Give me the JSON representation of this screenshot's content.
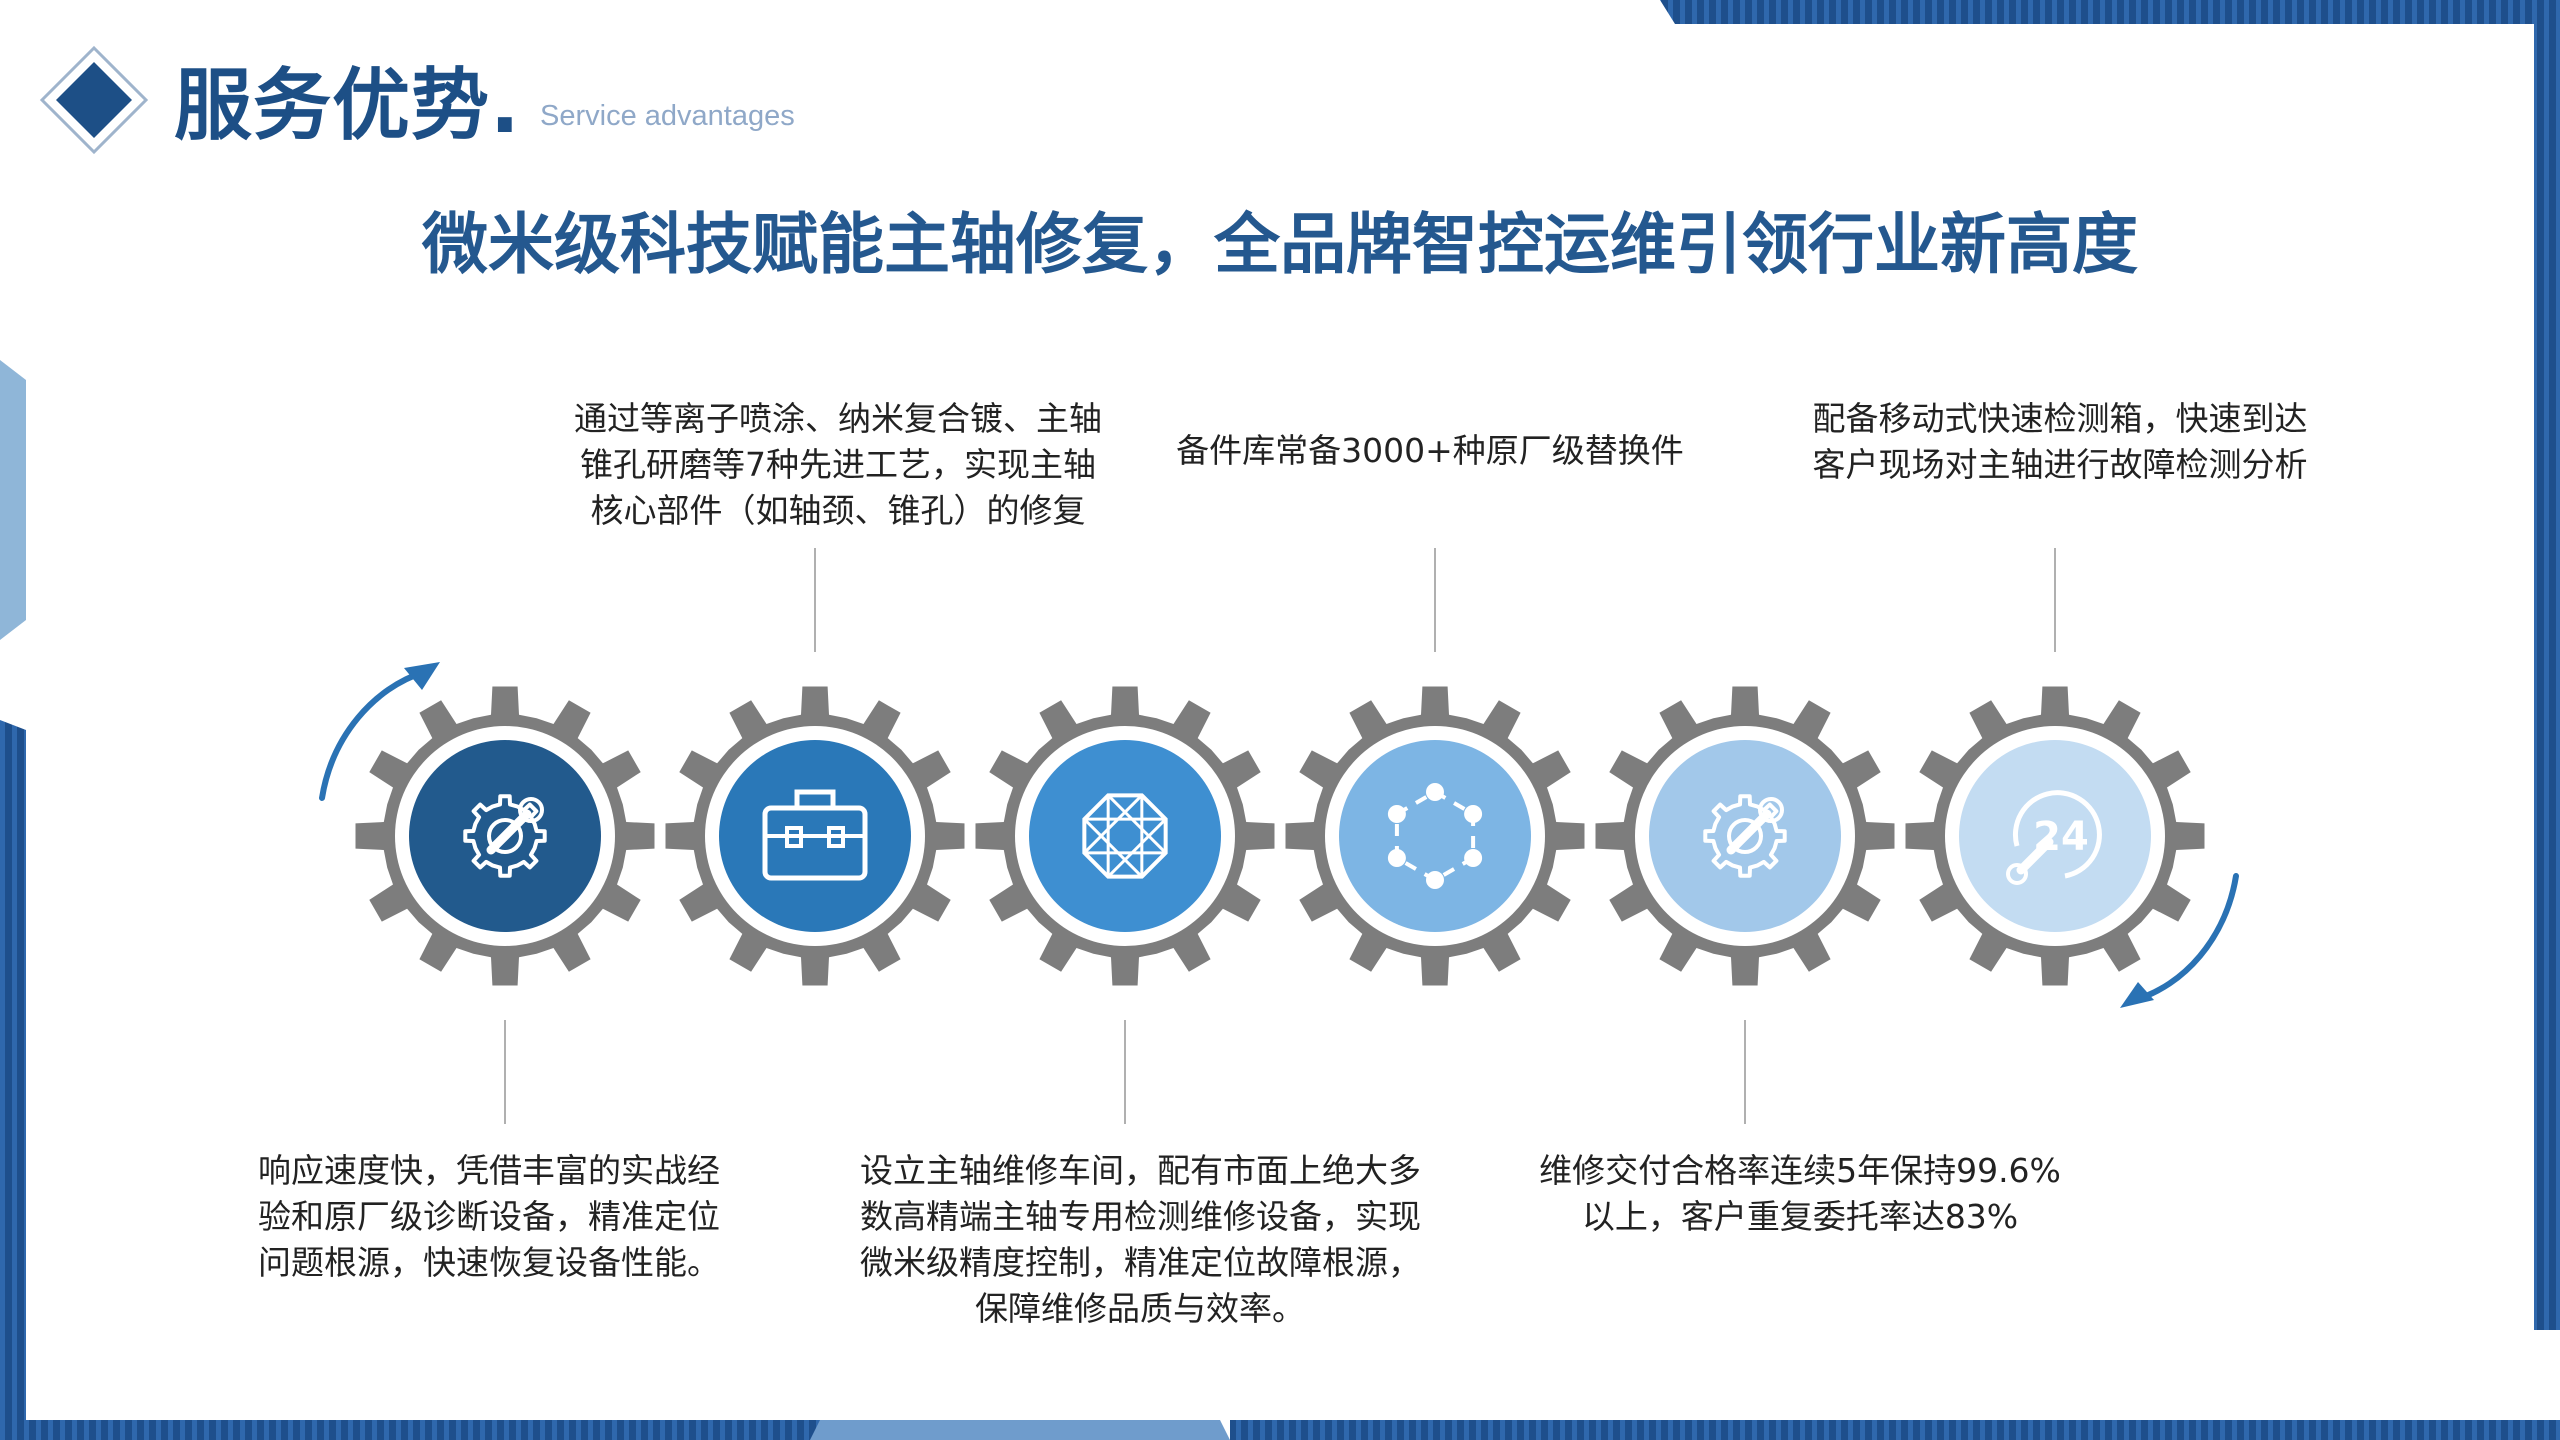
{
  "header": {
    "title": "服务优势.",
    "subtitle": "Service advantages"
  },
  "headline": "微米级科技赋能主轴修复，全品牌智控运维引领行业新高度",
  "colors": {
    "brand_dark": "#1d4f86",
    "gear_gray": "#7d7d7d",
    "circles": [
      "#225a8d",
      "#2a78b8",
      "#3e8fd1",
      "#7db5e4",
      "#a2c8ea",
      "#c3dcf2"
    ]
  },
  "gears": [
    {
      "icon": "wrench-gear-icon"
    },
    {
      "icon": "briefcase-icon"
    },
    {
      "icon": "diamond-icon"
    },
    {
      "icon": "hexagon-nodes-icon"
    },
    {
      "icon": "wrench-gear-icon"
    },
    {
      "icon": "24-hour-service-icon"
    }
  ],
  "descriptions": {
    "top": [
      {
        "lines": [
          "通过等离子喷涂、纳米复合镀、主轴",
          "锥孔研磨等7种先进工艺，实现主轴",
          "核心部件（如轴颈、锥孔）的修复"
        ]
      },
      {
        "lines": [
          "备件库常备3000+种原厂级替换件"
        ]
      },
      {
        "lines": [
          "配备移动式快速检测箱，快速到达",
          "客户现场对主轴进行故障检测分析"
        ]
      }
    ],
    "bottom": [
      {
        "lines": [
          "响应速度快，凭借丰富的实战经",
          "验和原厂级诊断设备，精准定位",
          "问题根源，快速恢复设备性能。"
        ]
      },
      {
        "lines": [
          "设立主轴维修车间，配有市面上绝大多",
          "数高精端主轴专用检测维修设备，实现",
          "微米级精度控制，精准定位故障根源，",
          "保障维修品质与效率。"
        ]
      },
      {
        "lines": [
          "维修交付合格率连续5年保持99.6%",
          "以上，客户重复委托率达83%"
        ]
      }
    ]
  }
}
